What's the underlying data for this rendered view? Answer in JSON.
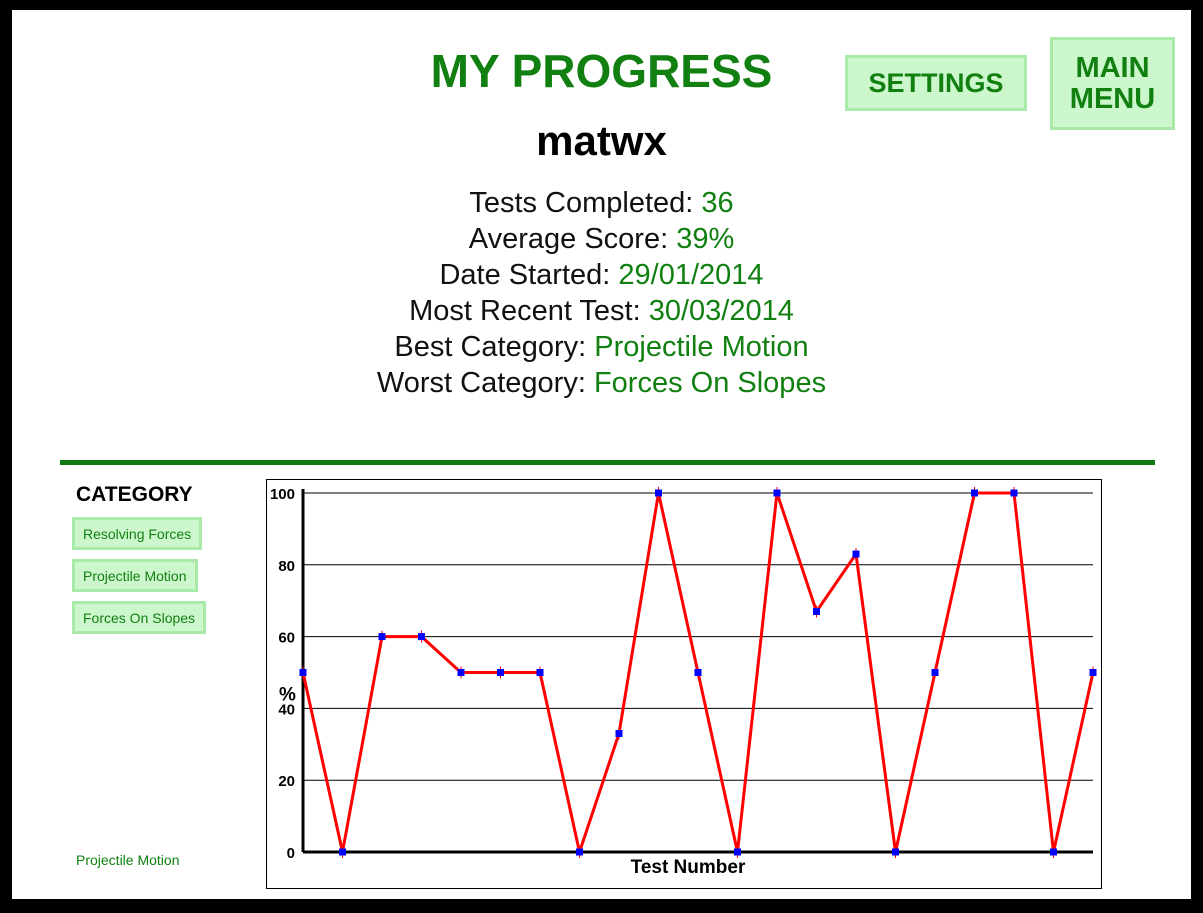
{
  "header": {
    "title": "MY PROGRESS",
    "username": "matwx",
    "settings_label": "SETTINGS",
    "main_menu_line1": "MAIN",
    "main_menu_line2": "MENU"
  },
  "stats": [
    {
      "label": "Tests Completed: ",
      "value": "36"
    },
    {
      "label": "Average Score: ",
      "value": "39%"
    },
    {
      "label": "Date Started: ",
      "value": "29/01/2014"
    },
    {
      "label": "Most Recent Test: ",
      "value": "30/03/2014"
    },
    {
      "label": "Best Category: ",
      "value": "Projectile Motion"
    },
    {
      "label": "Worst Category: ",
      "value": "Forces On Slopes"
    }
  ],
  "categories": {
    "heading": "CATEGORY",
    "items": [
      "Resolving Forces",
      "Projectile Motion",
      "Forces On Slopes"
    ],
    "selected": "Projectile Motion"
  },
  "colors": {
    "accent": "#118011",
    "line": "#ff0000",
    "marker": "#0000ff",
    "button_bg": "#ccf7cc"
  },
  "chart_data": {
    "type": "line",
    "xlabel": "Test Number",
    "ylabel": "%",
    "ylim": [
      0,
      100
    ],
    "yticks": [
      0,
      20,
      40,
      60,
      80,
      100
    ],
    "grid": true,
    "values": [
      50,
      0,
      60,
      60,
      50,
      50,
      50,
      0,
      33,
      100,
      50,
      0,
      100,
      67,
      83,
      0,
      50,
      100,
      100,
      0,
      50
    ]
  }
}
